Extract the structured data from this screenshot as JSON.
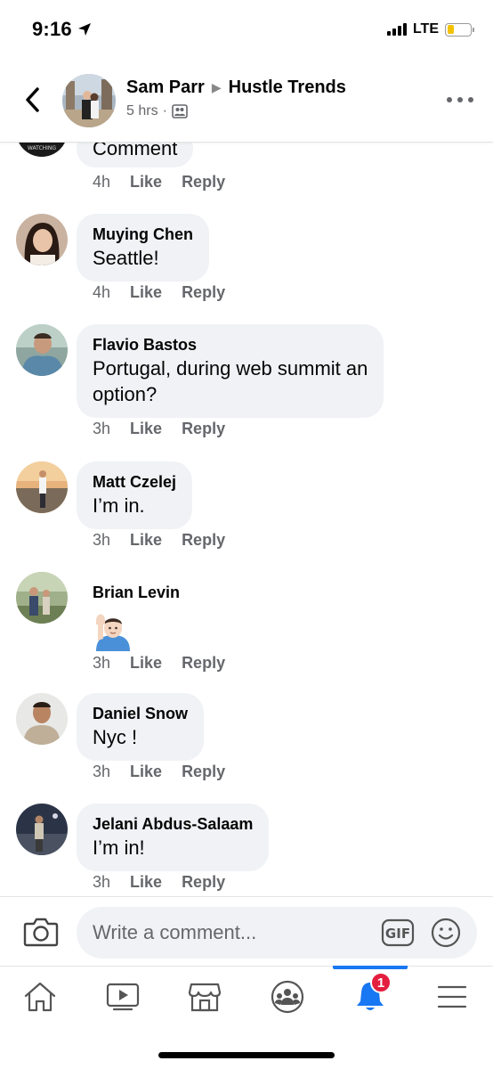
{
  "status_bar": {
    "time": "9:16",
    "network": "LTE"
  },
  "header": {
    "author": "Sam Parr",
    "group": "Hustle Trends",
    "time_ago": "5 hrs",
    "separator": "·"
  },
  "comments": [
    {
      "name": "",
      "text": "Comment",
      "time": "4h",
      "like": "Like",
      "reply": "Reply"
    },
    {
      "name": "Muying Chen",
      "text": "Seattle!",
      "time": "4h",
      "like": "Like",
      "reply": "Reply"
    },
    {
      "name": "Flavio Bastos",
      "text_line1": "Portugal, during web summit an",
      "text_line2": "option?",
      "time": "3h",
      "like": "Like",
      "reply": "Reply"
    },
    {
      "name": "Matt Czelej",
      "text": "I’m in.",
      "time": "3h",
      "like": "Like",
      "reply": "Reply"
    },
    {
      "name": "Brian Levin",
      "emoji": "raising-hand-emoji",
      "time": "3h",
      "like": "Like",
      "reply": "Reply"
    },
    {
      "name": "Daniel Snow",
      "text": "Nyc !",
      "time": "3h",
      "like": "Like",
      "reply": "Reply"
    },
    {
      "name": "Jelani Abdus-Salaam",
      "text": "I’m in!",
      "time": "3h",
      "like": "Like",
      "reply": "Reply"
    }
  ],
  "composer": {
    "placeholder": "Write a comment...",
    "gif_label": "GIF"
  },
  "tab_bar": {
    "notification_count": "1",
    "active_tab": "notifications",
    "accent_color": "#1877f2",
    "badge_color": "#e41e3f"
  },
  "colors": {
    "bubble": "#f0f2f5",
    "secondary_text": "#65676b"
  }
}
